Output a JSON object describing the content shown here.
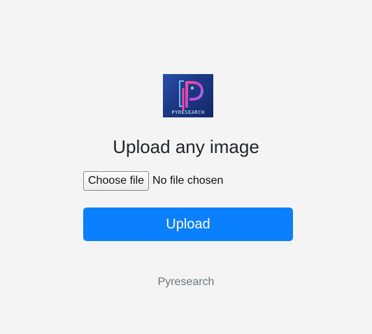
{
  "logo": {
    "icon": "pyresearch-logo",
    "wordmark": "PYRESEARCH",
    "colors": {
      "bg": "#1d3a86",
      "accent": "#e0408f",
      "accent2": "#6fb6ff"
    }
  },
  "heading": "Upload any image",
  "file_input": {
    "button_label": "Choose file",
    "status": "No file chosen"
  },
  "upload_button": {
    "label": "Upload",
    "color": "#0a80ff"
  },
  "footer": {
    "text": "Pyresearch"
  }
}
